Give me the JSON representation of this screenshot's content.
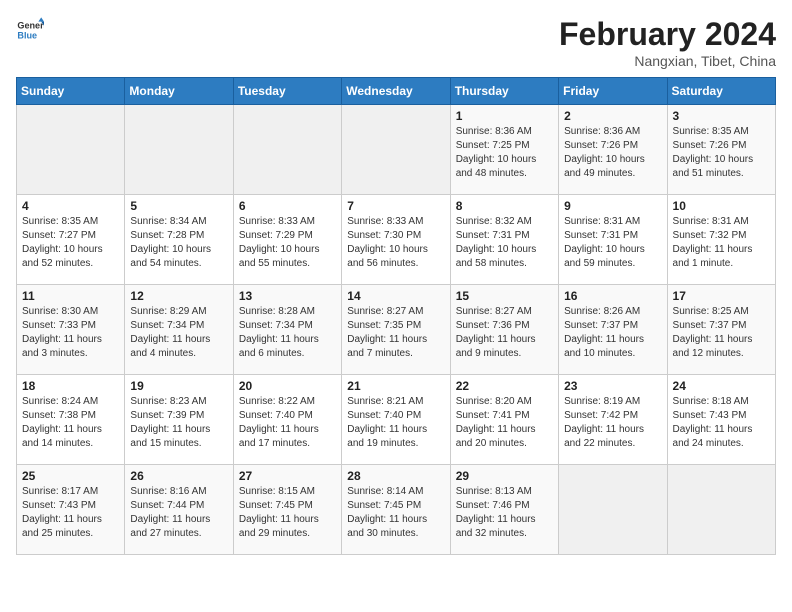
{
  "header": {
    "logo_line1": "General",
    "logo_line2": "Blue",
    "month_year": "February 2024",
    "location": "Nangxian, Tibet, China"
  },
  "weekdays": [
    "Sunday",
    "Monday",
    "Tuesday",
    "Wednesday",
    "Thursday",
    "Friday",
    "Saturday"
  ],
  "weeks": [
    [
      {
        "day": "",
        "info": ""
      },
      {
        "day": "",
        "info": ""
      },
      {
        "day": "",
        "info": ""
      },
      {
        "day": "",
        "info": ""
      },
      {
        "day": "1",
        "info": "Sunrise: 8:36 AM\nSunset: 7:25 PM\nDaylight: 10 hours\nand 48 minutes."
      },
      {
        "day": "2",
        "info": "Sunrise: 8:36 AM\nSunset: 7:26 PM\nDaylight: 10 hours\nand 49 minutes."
      },
      {
        "day": "3",
        "info": "Sunrise: 8:35 AM\nSunset: 7:26 PM\nDaylight: 10 hours\nand 51 minutes."
      }
    ],
    [
      {
        "day": "4",
        "info": "Sunrise: 8:35 AM\nSunset: 7:27 PM\nDaylight: 10 hours\nand 52 minutes."
      },
      {
        "day": "5",
        "info": "Sunrise: 8:34 AM\nSunset: 7:28 PM\nDaylight: 10 hours\nand 54 minutes."
      },
      {
        "day": "6",
        "info": "Sunrise: 8:33 AM\nSunset: 7:29 PM\nDaylight: 10 hours\nand 55 minutes."
      },
      {
        "day": "7",
        "info": "Sunrise: 8:33 AM\nSunset: 7:30 PM\nDaylight: 10 hours\nand 56 minutes."
      },
      {
        "day": "8",
        "info": "Sunrise: 8:32 AM\nSunset: 7:31 PM\nDaylight: 10 hours\nand 58 minutes."
      },
      {
        "day": "9",
        "info": "Sunrise: 8:31 AM\nSunset: 7:31 PM\nDaylight: 10 hours\nand 59 minutes."
      },
      {
        "day": "10",
        "info": "Sunrise: 8:31 AM\nSunset: 7:32 PM\nDaylight: 11 hours\nand 1 minute."
      }
    ],
    [
      {
        "day": "11",
        "info": "Sunrise: 8:30 AM\nSunset: 7:33 PM\nDaylight: 11 hours\nand 3 minutes."
      },
      {
        "day": "12",
        "info": "Sunrise: 8:29 AM\nSunset: 7:34 PM\nDaylight: 11 hours\nand 4 minutes."
      },
      {
        "day": "13",
        "info": "Sunrise: 8:28 AM\nSunset: 7:34 PM\nDaylight: 11 hours\nand 6 minutes."
      },
      {
        "day": "14",
        "info": "Sunrise: 8:27 AM\nSunset: 7:35 PM\nDaylight: 11 hours\nand 7 minutes."
      },
      {
        "day": "15",
        "info": "Sunrise: 8:27 AM\nSunset: 7:36 PM\nDaylight: 11 hours\nand 9 minutes."
      },
      {
        "day": "16",
        "info": "Sunrise: 8:26 AM\nSunset: 7:37 PM\nDaylight: 11 hours\nand 10 minutes."
      },
      {
        "day": "17",
        "info": "Sunrise: 8:25 AM\nSunset: 7:37 PM\nDaylight: 11 hours\nand 12 minutes."
      }
    ],
    [
      {
        "day": "18",
        "info": "Sunrise: 8:24 AM\nSunset: 7:38 PM\nDaylight: 11 hours\nand 14 minutes."
      },
      {
        "day": "19",
        "info": "Sunrise: 8:23 AM\nSunset: 7:39 PM\nDaylight: 11 hours\nand 15 minutes."
      },
      {
        "day": "20",
        "info": "Sunrise: 8:22 AM\nSunset: 7:40 PM\nDaylight: 11 hours\nand 17 minutes."
      },
      {
        "day": "21",
        "info": "Sunrise: 8:21 AM\nSunset: 7:40 PM\nDaylight: 11 hours\nand 19 minutes."
      },
      {
        "day": "22",
        "info": "Sunrise: 8:20 AM\nSunset: 7:41 PM\nDaylight: 11 hours\nand 20 minutes."
      },
      {
        "day": "23",
        "info": "Sunrise: 8:19 AM\nSunset: 7:42 PM\nDaylight: 11 hours\nand 22 minutes."
      },
      {
        "day": "24",
        "info": "Sunrise: 8:18 AM\nSunset: 7:43 PM\nDaylight: 11 hours\nand 24 minutes."
      }
    ],
    [
      {
        "day": "25",
        "info": "Sunrise: 8:17 AM\nSunset: 7:43 PM\nDaylight: 11 hours\nand 25 minutes."
      },
      {
        "day": "26",
        "info": "Sunrise: 8:16 AM\nSunset: 7:44 PM\nDaylight: 11 hours\nand 27 minutes."
      },
      {
        "day": "27",
        "info": "Sunrise: 8:15 AM\nSunset: 7:45 PM\nDaylight: 11 hours\nand 29 minutes."
      },
      {
        "day": "28",
        "info": "Sunrise: 8:14 AM\nSunset: 7:45 PM\nDaylight: 11 hours\nand 30 minutes."
      },
      {
        "day": "29",
        "info": "Sunrise: 8:13 AM\nSunset: 7:46 PM\nDaylight: 11 hours\nand 32 minutes."
      },
      {
        "day": "",
        "info": ""
      },
      {
        "day": "",
        "info": ""
      }
    ]
  ]
}
